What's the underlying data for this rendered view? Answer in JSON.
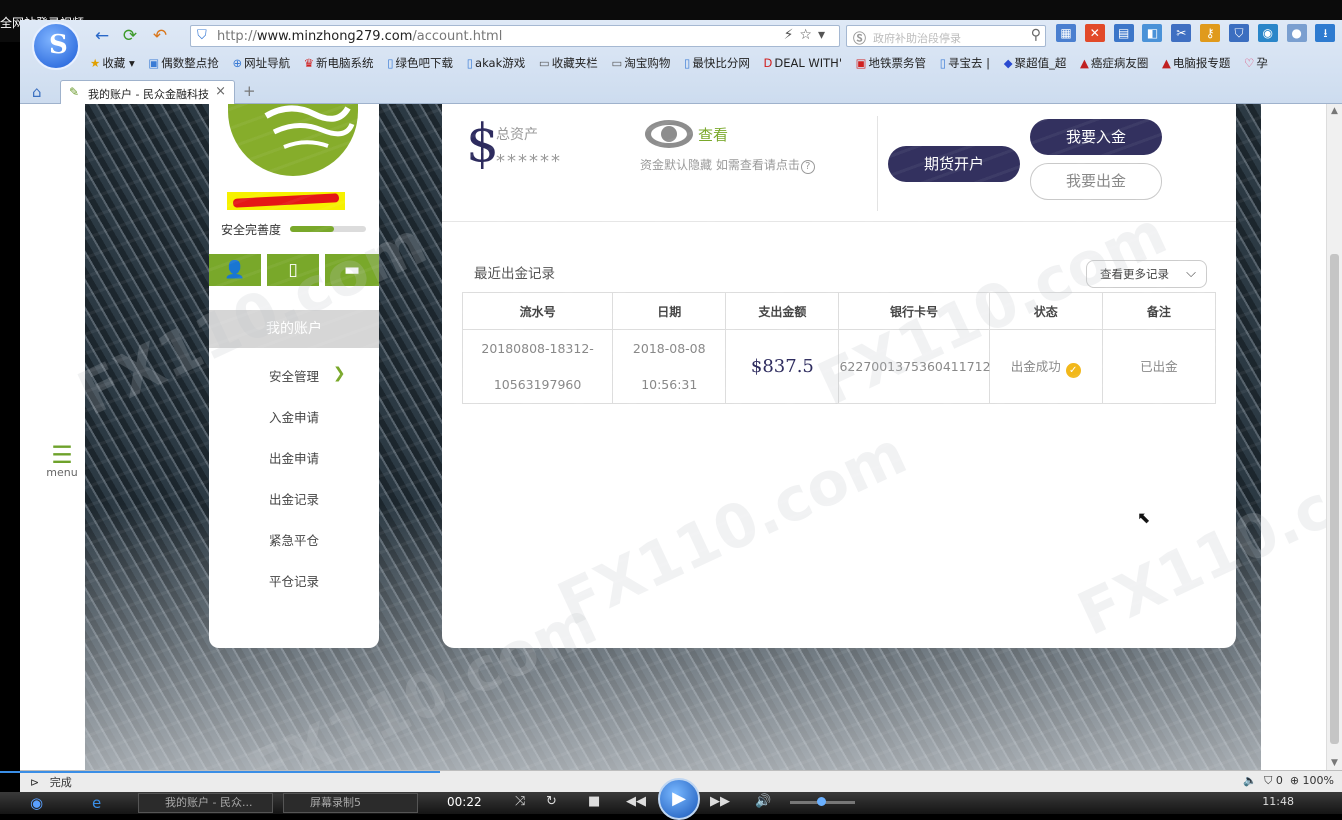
{
  "video_title": "全网站登录视频",
  "browser": {
    "url_prefix": "http://",
    "url_domain": "www.minzhong279.com",
    "url_path": "/account.html",
    "search_placeholder": "政府补助治段停录",
    "bookmarks": [
      "收藏",
      "偶数整点抢",
      "网址导航",
      "新电脑系统",
      "绿色吧下载",
      "akak游戏",
      "收藏夹栏",
      "淘宝购物",
      "最快比分网",
      "DEAL WITH'",
      "地铁票务管",
      "寻宝去 |",
      "聚超值_超",
      "癌症病友圈",
      "电脑报专题",
      "孕"
    ],
    "tab_title": "我的账户 - 民众金融科技",
    "status_left": "完成",
    "status_right": "0",
    "zoom": "100%"
  },
  "menu_label": "menu",
  "sidebar": {
    "security_label": "安全完善度",
    "security_level": 0.58,
    "my_account": "我的账户",
    "items": [
      "安全管理",
      "入金申请",
      "出金申请",
      "出金记录",
      "紧急平仓",
      "平仓记录"
    ]
  },
  "account": {
    "total_label": "总资产",
    "currency_symbol": "$",
    "masked_value": "******",
    "view_label": "查看",
    "hidden_note": "资金默认隐藏 如需查看请点击",
    "help_symbol": "?",
    "futures_button": "期货开户",
    "deposit_button": "我要入金",
    "withdraw_button": "我要出金"
  },
  "records": {
    "title": "最近出金记录",
    "more_button": "查看更多记录",
    "columns": [
      "流水号",
      "日期",
      "支出金额",
      "银行卡号",
      "状态",
      "备注"
    ],
    "rows": [
      {
        "serial_1": "20180808-18312-",
        "serial_2": "10563197960",
        "date_1": "2018-08-08",
        "date_2": "10:56:31",
        "amount": "$837.5",
        "card": "6227001375360411712",
        "status": "出金成功",
        "note": "已出金"
      }
    ]
  },
  "watermark": "FX110.com",
  "player": {
    "time": "00:22",
    "task_items": [
      "我的账户 - 民众...",
      "屏幕录制5"
    ],
    "clock": "11:48"
  },
  "colors": {
    "accent_green": "#79a82a",
    "navy": "#33315f",
    "status_yellow": "#f2b81b"
  }
}
